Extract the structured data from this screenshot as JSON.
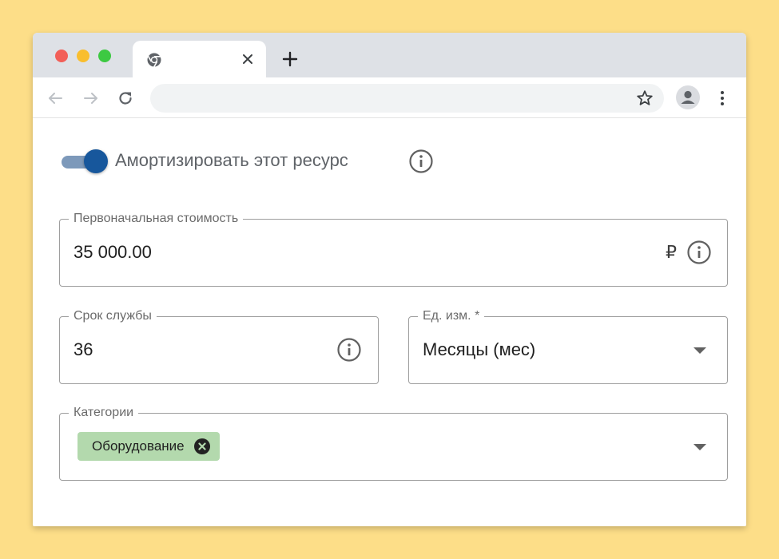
{
  "browser": {
    "tab_close_glyph": "×",
    "new_tab_glyph": "+",
    "address": ""
  },
  "depreciation": {
    "toggle_on": true,
    "label": "Амортизировать этот ресурс"
  },
  "form": {
    "initial_cost": {
      "label": "Первоначальная стоимость",
      "value": "35 000.00",
      "currency": "₽"
    },
    "service_life": {
      "label": "Срок службы",
      "value": "36"
    },
    "unit": {
      "label": "Ед. изм. *",
      "value": "Месяцы (мес)"
    },
    "categories": {
      "label": "Категории",
      "chips": [
        {
          "label": "Оборудование"
        }
      ]
    }
  },
  "colors": {
    "page_background": "#fdde88",
    "toggle_accent": "#17579c",
    "chip_background": "#b3d9ad"
  }
}
